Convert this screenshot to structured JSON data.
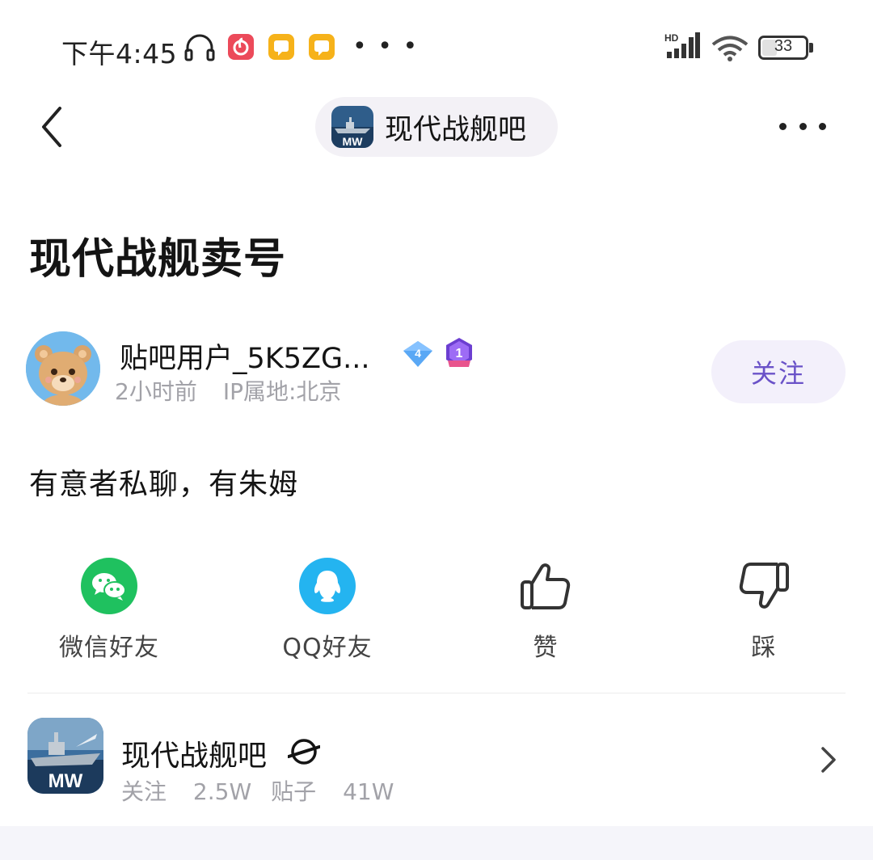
{
  "status_bar": {
    "time": "下午4:45",
    "overflow": "• • •",
    "network": "HD",
    "battery_level": "33",
    "battery_fraction": 0.33
  },
  "nav": {
    "back_icon": "chevron-left-icon",
    "forum_name": "现代战舰吧",
    "logo_text": "MW",
    "more_icon": "more-horizontal-icon"
  },
  "post": {
    "title": "现代战舰卖号",
    "author": {
      "name": "贴吧用户_5K5ZG...",
      "level": "4",
      "rank": "1",
      "time": "2小时前",
      "ip": "IP属地:北京"
    },
    "follow_label": "关注",
    "content": "有意者私聊，有朱姆"
  },
  "actions": [
    {
      "icon": "wechat-icon",
      "label": "微信好友",
      "color": "#1fc15f"
    },
    {
      "icon": "qq-icon",
      "label": "QQ好友",
      "color": "#24b4f0"
    },
    {
      "icon": "thumbs-up-icon",
      "label": "赞"
    },
    {
      "icon": "thumbs-down-icon",
      "label": "踩"
    }
  ],
  "forum_card": {
    "name": "现代战舰吧",
    "logo_text": "MW",
    "followers_label": "关注",
    "followers": "2.5W",
    "posts_label": "贴子",
    "posts": "41W"
  },
  "colors": {
    "accent": "#6a52c8",
    "follow_bg": "#f3f0fb",
    "muted_text": "#a2a2a8",
    "pill_bg": "#f3f1f6"
  }
}
